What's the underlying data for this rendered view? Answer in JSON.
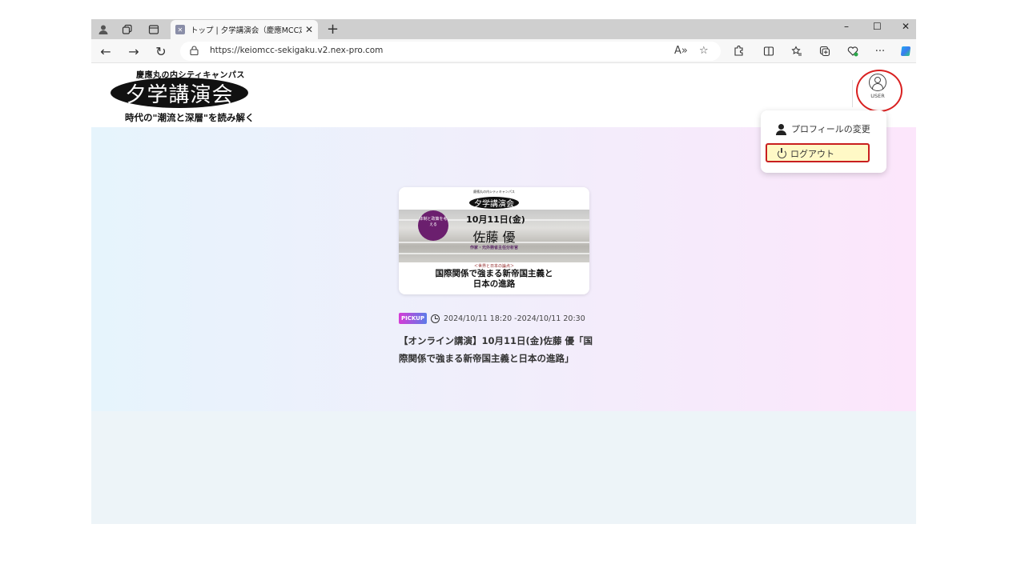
{
  "browser": {
    "tab": {
      "favicon_icon": "site-favicon-icon",
      "title": "トップ | 夕学講演会（慶應MCC定",
      "close": "✕"
    },
    "new_tab": "+",
    "window_controls": {
      "minimize": "–",
      "maximize": "☐",
      "close": "✕"
    },
    "nav": {
      "back": "←",
      "forward": "→",
      "refresh": "↻"
    },
    "url": "https://keiomcc-sekigaku.v2.nex-pro.com",
    "read_aloud": "A»",
    "favorite": "☆",
    "toolbar_icons": [
      "extensions-icon",
      "split-screen-icon",
      "favorites-icon",
      "collections-icon",
      "health-icon",
      "more-icon",
      "copilot-icon"
    ],
    "more": "···"
  },
  "site": {
    "logo_top": "慶應丸の内シティキャンパス",
    "logo_main": "夕学講演会",
    "logo_sub": "時代の\"潮流と深層\"を読み解く",
    "user_label": "USER"
  },
  "dropdown": {
    "profile": "プロフィールの変更",
    "logout": "ログアウト"
  },
  "card": {
    "image": {
      "top_text": "慶應丸の内シティキャンパス",
      "logo": "夕学講演会",
      "sub": "時代の\"潮流と深層\"を読み解く",
      "badge": "体制と政策を考える",
      "date": "10月11日(金)",
      "name": "佐藤 優",
      "role": "作家・元外務省主任分析官",
      "small": "＜世界と日本の論点＞",
      "title_line1": "国際関係で強まる新帝国主義と",
      "title_line2": "日本の進路"
    },
    "pickup": "PICKUP",
    "datetime": "2024/10/11 18:20 -2024/10/11 20:30",
    "title": "【オンライン講演】10月11日(金)佐藤 優「国際関係で強まる新帝国主義と日本の進路」"
  },
  "colors": {
    "accent_red": "#d92020",
    "logout_highlight": "#fff9c6",
    "pickup_gradient": [
      "#d63bd6",
      "#5b7ce8"
    ],
    "badge_purple": "#6b1f6e"
  }
}
